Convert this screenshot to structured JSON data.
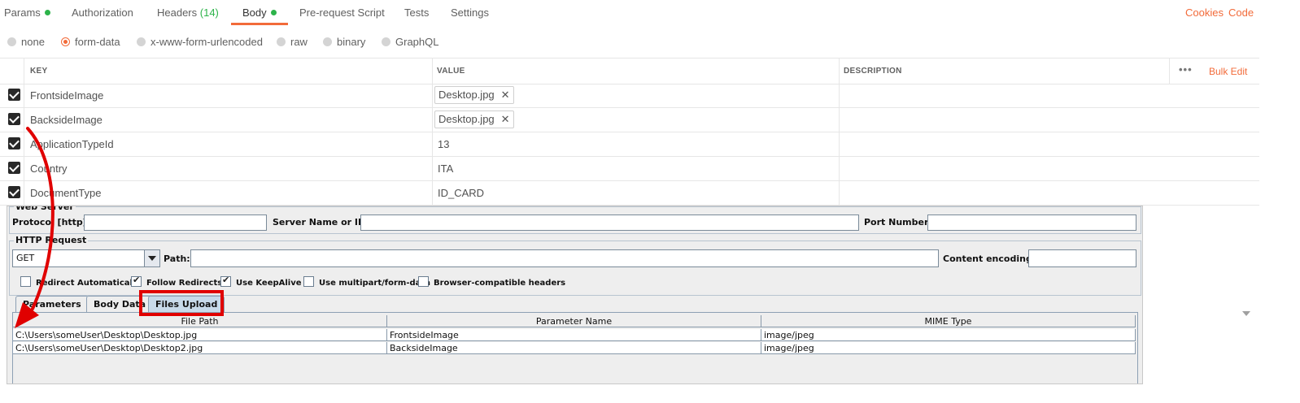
{
  "tabs": [
    {
      "label": "Params",
      "dot": true
    },
    {
      "label": "Authorization"
    },
    {
      "label": "Headers",
      "count": "(14)"
    },
    {
      "label": "Body",
      "dot": true,
      "active": true
    },
    {
      "label": "Pre-request Script"
    },
    {
      "label": "Tests"
    },
    {
      "label": "Settings"
    }
  ],
  "links": {
    "cookies": "Cookies",
    "code": "Code"
  },
  "body_types": [
    "none",
    "form-data",
    "x-www-form-urlencoded",
    "raw",
    "binary",
    "GraphQL"
  ],
  "selected_body_type": "form-data",
  "kv_table": {
    "headers": {
      "key": "KEY",
      "value": "VALUE",
      "description": "DESCRIPTION"
    },
    "more": "•••",
    "bulk_edit": "Bulk Edit",
    "rows": [
      {
        "key": "FrontsideImage",
        "value": "Desktop.jpg",
        "file": true
      },
      {
        "key": "BacksideImage",
        "value": "Desktop.jpg",
        "file": true
      },
      {
        "key": "ApplicationTypeId",
        "value": "13"
      },
      {
        "key": "Country",
        "value": "ITA"
      },
      {
        "key": "DocumentType",
        "value": "ID_CARD"
      }
    ],
    "remove_icon": "✕"
  },
  "jmeter": {
    "web_server": {
      "legend": "Web Server",
      "protocol_label": "Protocol [http]:",
      "server_label": "Server Name or IP:",
      "port_label": "Port Number:"
    },
    "http_request": {
      "legend": "HTTP Request",
      "method": "GET",
      "path_label": "Path:",
      "encoding_label": "Content encoding:"
    },
    "options": [
      {
        "label": "Redirect Automatically",
        "checked": false
      },
      {
        "label": "Follow Redirects",
        "checked": true
      },
      {
        "label": "Use KeepAlive",
        "checked": true
      },
      {
        "label": "Use multipart/form-data",
        "checked": false
      },
      {
        "label": "Browser-compatible headers",
        "checked": false
      }
    ],
    "tabs": [
      "Parameters",
      "Body Data",
      "Files Upload"
    ],
    "active_tab": "Files Upload",
    "files_table": {
      "columns": [
        "File Path",
        "Parameter Name",
        "MIME Type"
      ],
      "rows": [
        [
          "C:\\Users\\someUser\\Desktop\\Desktop.jpg",
          "FrontsideImage",
          "image/jpeg"
        ],
        [
          "C:\\Users\\someUser\\Desktop\\Desktop2.jpg",
          "BacksideImage",
          "image/jpeg"
        ]
      ]
    }
  },
  "colors": {
    "accent": "#f26b3a",
    "status": "#2db34a",
    "highlight": "#e00000"
  }
}
